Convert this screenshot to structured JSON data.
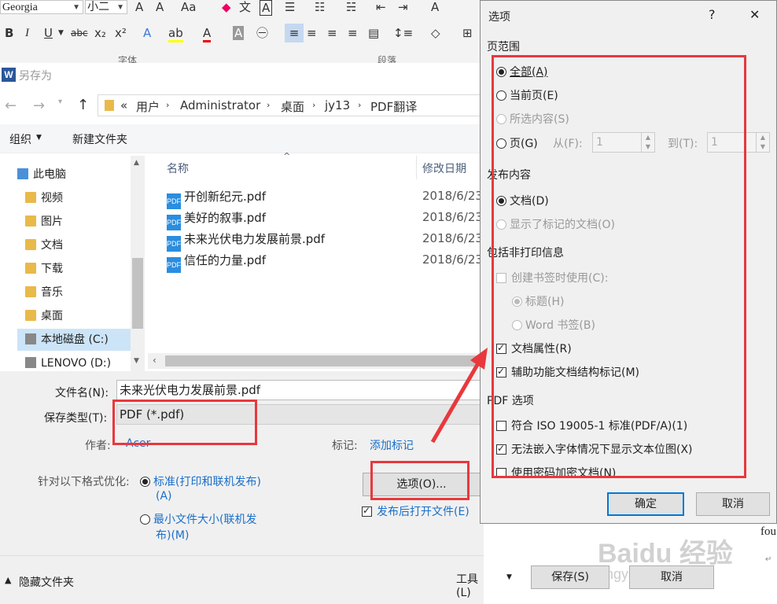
{
  "ribbon": {
    "font_name": "Georgia",
    "font_size": "小二",
    "group_font": "字体",
    "group_paragraph": "段落"
  },
  "save_dialog": {
    "title": "另存为",
    "breadcrumb": [
      "«",
      "用户",
      "Administrator",
      "桌面",
      "jy13",
      "PDF翻译"
    ],
    "organize": "组织",
    "new_folder": "新建文件夹",
    "tree": [
      "此电脑",
      "视频",
      "图片",
      "文档",
      "下载",
      "音乐",
      "桌面",
      "本地磁盘 (C:)",
      "LENOVO (D:)"
    ],
    "columns": {
      "name": "名称",
      "modified": "修改日期"
    },
    "files": [
      {
        "name": "开创新纪元.pdf",
        "date": "2018/6/23"
      },
      {
        "name": "美好的叙事.pdf",
        "date": "2018/6/23"
      },
      {
        "name": "未来光伏电力发展前景.pdf",
        "date": "2018/6/23"
      },
      {
        "name": "信任的力量.pdf",
        "date": "2018/6/23"
      }
    ],
    "filename_label": "文件名(N):",
    "filename_value": "未来光伏电力发展前景.pdf",
    "filetype_label": "保存类型(T):",
    "filetype_value": "PDF (*.pdf)",
    "author_label": "作者:",
    "author_value": "Acer",
    "tags_label": "标记:",
    "tags_value": "添加标记",
    "optimize_label": "针对以下格式优化:",
    "opt_standard_1": "标准(打印和联机发布)",
    "opt_standard_2": "(A)",
    "opt_min_1": "最小文件大小(联机发",
    "opt_min_2": "布)(M)",
    "options_button": "选项(O)...",
    "open_after": "发布后打开文件(E)",
    "hide_folders": "隐藏文件夹",
    "tools": "工具(L)",
    "save": "保存(S)",
    "cancel": "取消"
  },
  "options_dialog": {
    "title": "选项",
    "help": "?",
    "close": "✕",
    "page_range": "页范围",
    "all": "全部(A)",
    "current_page": "当前页(E)",
    "selection": "所选内容(S)",
    "pages": "页(G)",
    "from": "从(F):",
    "from_value": "1",
    "to": "到(T):",
    "to_value": "1",
    "publish_what": "发布内容",
    "document": "文档(D)",
    "doc_markup": "显示了标记的文档(O)",
    "nonprint": "包括非打印信息",
    "create_bookmarks": "创建书签时使用(C):",
    "headings": "标题(H)",
    "word_bookmarks": "Word 书签(B)",
    "doc_props": "文档属性(R)",
    "struct_tags": "辅助功能文档结构标记(M)",
    "pdf_options": "PDF 选项",
    "iso": "符合 ISO 19005-1 标准(PDF/A)(1)",
    "bitmap": "无法嵌入字体情况下显示文本位图(X)",
    "encrypt": "使用密码加密文档(N)",
    "ok": "确定",
    "cancel": "取消"
  },
  "background_text": "fou",
  "watermark": "Baidu 经验",
  "watermark_url": "jingyan.baidu.com"
}
